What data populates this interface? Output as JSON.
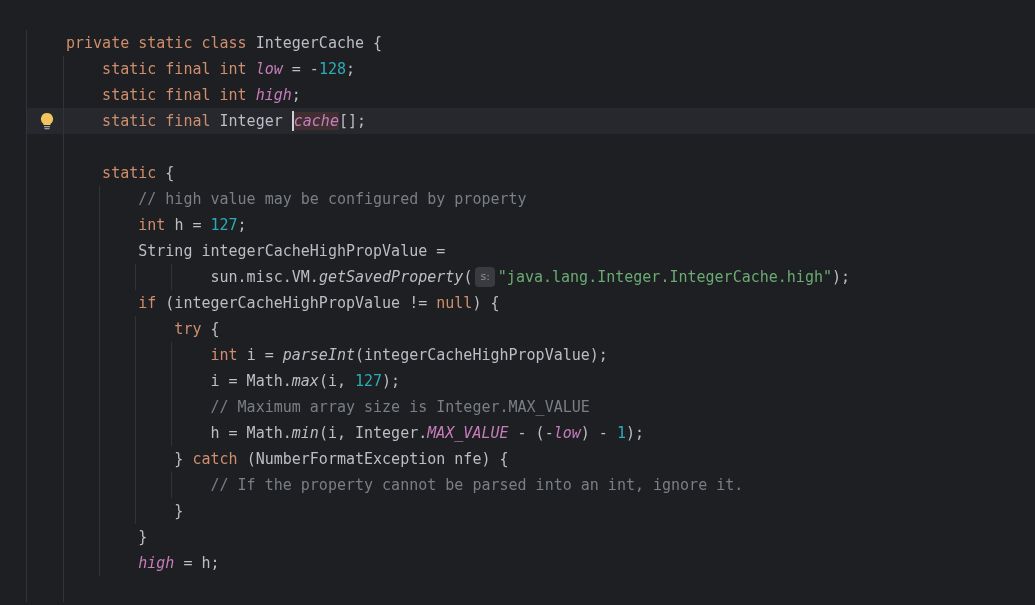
{
  "editor": {
    "lines": [
      {
        "tokens": [
          {
            "kind": "keyword",
            "text": "private static class "
          },
          {
            "kind": "plain",
            "text": "IntegerCache {"
          }
        ]
      },
      {
        "tokens": [
          {
            "kind": "keyword",
            "text": "    static final int "
          },
          {
            "kind": "field",
            "text": "low"
          },
          {
            "kind": "plain",
            "text": " = -"
          },
          {
            "kind": "number",
            "text": "128"
          },
          {
            "kind": "plain",
            "text": ";"
          }
        ]
      },
      {
        "tokens": [
          {
            "kind": "keyword",
            "text": "    static final int "
          },
          {
            "kind": "field",
            "text": "high"
          },
          {
            "kind": "plain",
            "text": ";"
          }
        ]
      },
      {
        "current": true,
        "bulb": true,
        "tokens": [
          {
            "kind": "keyword",
            "text": "    static final "
          },
          {
            "kind": "plain",
            "text": "Integer "
          },
          {
            "kind": "field",
            "text": "cache",
            "caret": true,
            "highlighted": true
          },
          {
            "kind": "plain",
            "text": "[];"
          }
        ]
      },
      {
        "kind": "blank"
      },
      {
        "tokens": [
          {
            "kind": "keyword",
            "text": "    static "
          },
          {
            "kind": "plain",
            "text": "{"
          }
        ]
      },
      {
        "tokens": [
          {
            "kind": "comment",
            "text": "        // high value may be configured by property"
          }
        ]
      },
      {
        "tokens": [
          {
            "kind": "keyword",
            "text": "        int "
          },
          {
            "kind": "plain",
            "text": "h = "
          },
          {
            "kind": "number",
            "text": "127"
          },
          {
            "kind": "plain",
            "text": ";"
          }
        ]
      },
      {
        "tokens": [
          {
            "kind": "plain",
            "text": "        String integerCacheHighPropValue ="
          }
        ]
      },
      {
        "tokens": [
          {
            "kind": "plain",
            "text": "                sun.misc.VM."
          },
          {
            "kind": "method",
            "text": "getSavedProperty"
          },
          {
            "kind": "plain",
            "text": "("
          },
          {
            "kind": "hint",
            "text": "s:"
          },
          {
            "kind": "string",
            "text": "\"java.lang.Integer.IntegerCache.high\""
          },
          {
            "kind": "plain",
            "text": ");"
          }
        ]
      },
      {
        "tokens": [
          {
            "kind": "keyword",
            "text": "        if "
          },
          {
            "kind": "plain",
            "text": "(integerCacheHighPropValue != "
          },
          {
            "kind": "keyword",
            "text": "null"
          },
          {
            "kind": "plain",
            "text": ") {"
          }
        ]
      },
      {
        "tokens": [
          {
            "kind": "keyword",
            "text": "            try "
          },
          {
            "kind": "plain",
            "text": "{"
          }
        ]
      },
      {
        "tokens": [
          {
            "kind": "keyword",
            "text": "                int "
          },
          {
            "kind": "plain",
            "text": "i = "
          },
          {
            "kind": "method",
            "text": "parseInt"
          },
          {
            "kind": "plain",
            "text": "(integerCacheHighPropValue);"
          }
        ]
      },
      {
        "tokens": [
          {
            "kind": "plain",
            "text": "                i = Math."
          },
          {
            "kind": "method",
            "text": "max"
          },
          {
            "kind": "plain",
            "text": "(i, "
          },
          {
            "kind": "number",
            "text": "127"
          },
          {
            "kind": "plain",
            "text": ");"
          }
        ]
      },
      {
        "tokens": [
          {
            "kind": "comment",
            "text": "                // Maximum array size is Integer.MAX_VALUE"
          }
        ]
      },
      {
        "tokens": [
          {
            "kind": "plain",
            "text": "                h = Math."
          },
          {
            "kind": "method",
            "text": "min"
          },
          {
            "kind": "plain",
            "text": "(i, Integer."
          },
          {
            "kind": "field",
            "text": "MAX_VALUE"
          },
          {
            "kind": "plain",
            "text": " - (-"
          },
          {
            "kind": "field",
            "text": "low"
          },
          {
            "kind": "plain",
            "text": ") - "
          },
          {
            "kind": "number",
            "text": "1"
          },
          {
            "kind": "plain",
            "text": ");"
          }
        ]
      },
      {
        "tokens": [
          {
            "kind": "plain",
            "text": "            } "
          },
          {
            "kind": "keyword",
            "text": "catch "
          },
          {
            "kind": "plain",
            "text": "(NumberFormatException nfe) {"
          }
        ]
      },
      {
        "tokens": [
          {
            "kind": "comment",
            "text": "                // If the property cannot be parsed into an int, ignore it."
          }
        ]
      },
      {
        "tokens": [
          {
            "kind": "plain",
            "text": "            }"
          }
        ]
      },
      {
        "tokens": [
          {
            "kind": "plain",
            "text": "        }"
          }
        ]
      },
      {
        "tokens": [
          {
            "kind": "field",
            "text": "        high"
          },
          {
            "kind": "plain",
            "text": " = h;"
          }
        ]
      },
      {
        "kind": "blank"
      }
    ]
  }
}
